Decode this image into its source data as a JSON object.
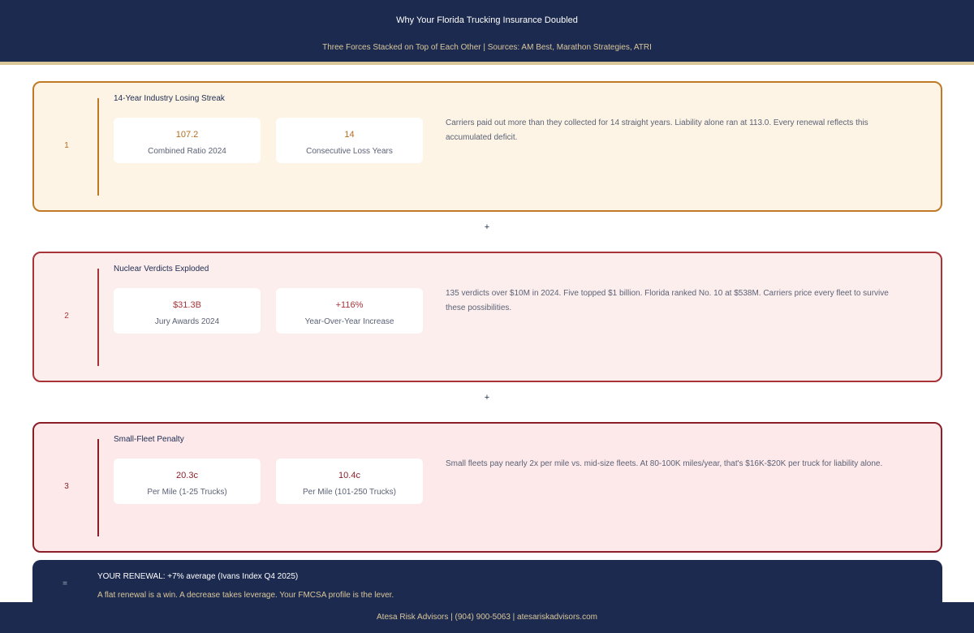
{
  "header": {
    "title": "Why Your Florida Trucking Insurance Doubled",
    "subtitle": "Three Forces Stacked on Top of Each Other  |  Sources: AM Best, Marathon Strategies, ATRI"
  },
  "cards": [
    {
      "number": "1",
      "title": "14-Year Industry Losing Streak",
      "stats": [
        {
          "value": "107.2",
          "label": "Combined Ratio 2024"
        },
        {
          "value": "14",
          "label": "Consecutive Loss Years"
        }
      ],
      "description": "Carriers paid out more than they collected for 14 straight years. Liability alone ran at 113.0. Every renewal reflects this accumulated deficit."
    },
    {
      "number": "2",
      "title": "Nuclear Verdicts Exploded",
      "stats": [
        {
          "value": "$31.3B",
          "label": "Jury Awards 2024"
        },
        {
          "value": "+116%",
          "label": "Year-Over-Year Increase"
        }
      ],
      "description": "135 verdicts over $10M in 2024. Five topped $1 billion. Florida ranked No. 10 at $538M. Carriers price every fleet to survive these possibilities."
    },
    {
      "number": "3",
      "title": "Small-Fleet Penalty",
      "stats": [
        {
          "value": "20.3c",
          "label": "Per Mile (1-25 Trucks)"
        },
        {
          "value": "10.4c",
          "label": "Per Mile (101-250 Trucks)"
        }
      ],
      "description": "Small fleets pay nearly 2x per mile vs. mid-size fleets. At 80-100K miles/year, that's $16K-$20K per truck for liability alone."
    }
  ],
  "operators": {
    "plus": "+"
  },
  "renewal": {
    "symbol": "=",
    "title": "YOUR RENEWAL: +7% average (Ivans Index Q4 2025)",
    "subtitle": "A flat renewal is a win. A decrease takes leverage. Your FMCSA profile is the lever."
  },
  "footer": {
    "text": "Atesa Risk Advisors  |  (904) 900-5063  |  atesariskadvisors.com"
  },
  "colors": {
    "navy": "#1c2a4f",
    "gold": "#d9c79a",
    "card1_accent": "#c07a26",
    "card2_accent": "#a8343a",
    "card3_accent": "#8a1f28"
  }
}
